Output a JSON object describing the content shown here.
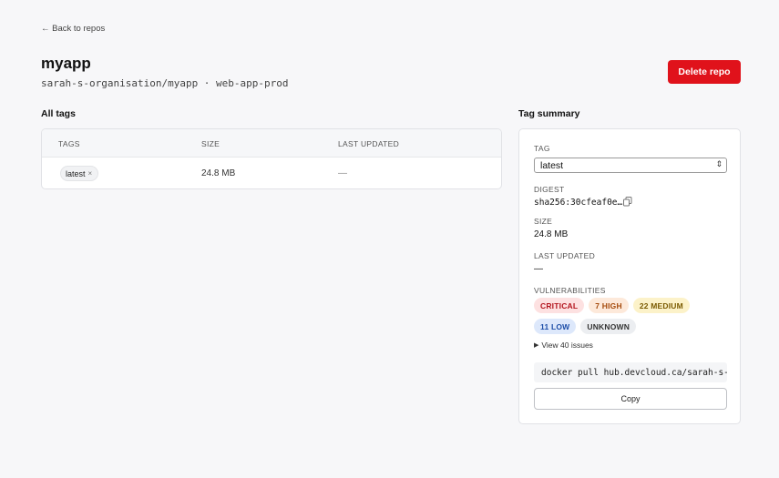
{
  "nav": {
    "back_label": "← Back to repos"
  },
  "repo": {
    "name": "myapp",
    "subtitle": "sarah-s-organisation/myapp · web-app-prod",
    "delete_label": "Delete repo"
  },
  "tags_section": {
    "heading": "All tags",
    "columns": [
      "TAGS",
      "SIZE",
      "LAST UPDATED"
    ],
    "rows": [
      {
        "tag": "latest",
        "size": "24.8 MB",
        "updated": "—"
      }
    ]
  },
  "summary": {
    "heading": "Tag summary",
    "tag_label": "TAG",
    "tag_selected": "latest",
    "digest_label": "DIGEST",
    "digest_value": "sha256:30cfeaf0e…",
    "size_label": "SIZE",
    "size_value": "24.8 MB",
    "updated_label": "LAST UPDATED",
    "updated_value": "—",
    "vuln_label": "VULNERABILITIES",
    "badges": {
      "critical": "CRITICAL",
      "high": "7 HIGH",
      "medium": "22 MEDIUM",
      "low": "11 LOW",
      "unknown": "UNKNOWN"
    },
    "view_issues": "View 40 issues",
    "pull_command": "docker pull hub.devcloud.ca/sarah-s-organisation/myapp:latest",
    "copy_label": "Copy"
  },
  "colors": {
    "danger": "#e0121b",
    "background": "#f7f7f9",
    "card": "#ffffff"
  },
  "icons": {
    "back": "arrow-left-icon",
    "remove_tag": "close-icon",
    "copy_digest": "copy-icon",
    "select": "chevron-updown-icon",
    "disclosure": "triangle-right-icon"
  }
}
